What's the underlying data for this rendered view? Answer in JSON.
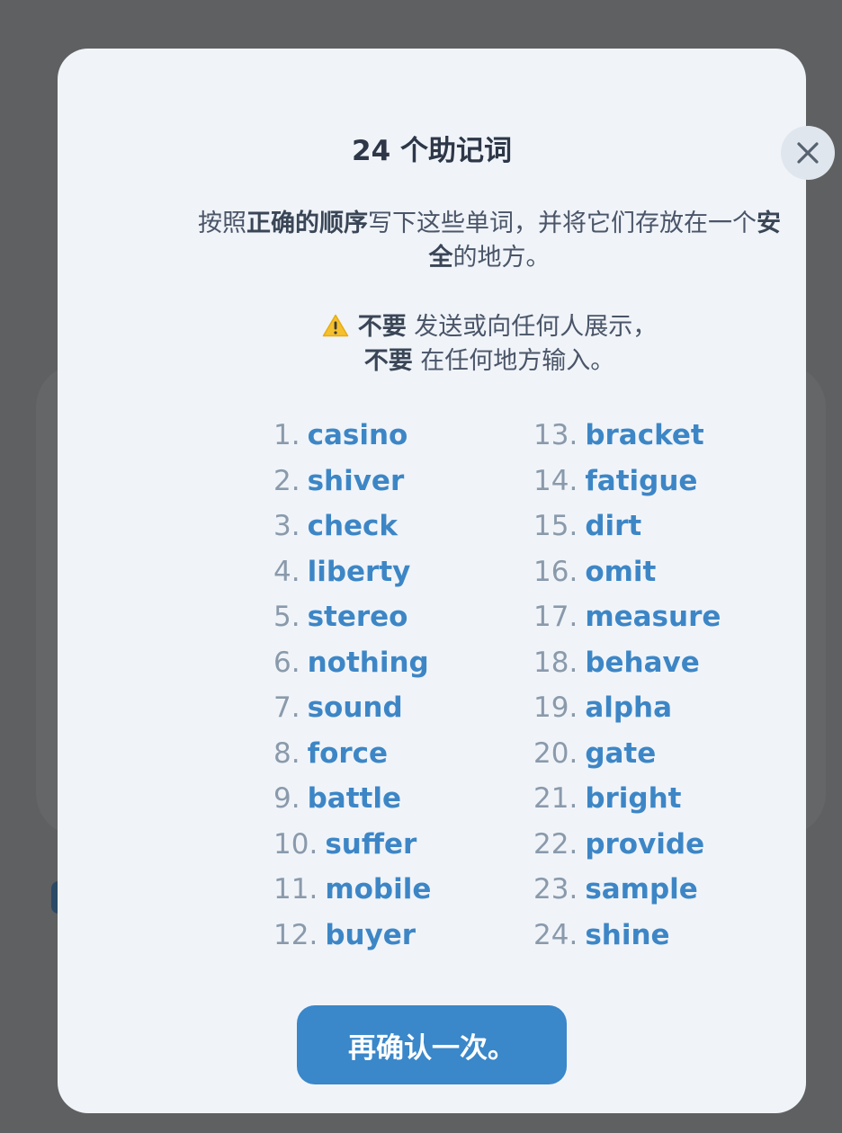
{
  "modal": {
    "title": "24 个助记词",
    "close_icon": "close-icon",
    "description": {
      "p1": "按照",
      "b1": "正确的顺序",
      "p2": "写下这些单词，并将它们存放在一个",
      "b2": "安全",
      "p3": "的地方。"
    },
    "warning": {
      "icon": "warning-icon",
      "bold1": "不要",
      "text1": " 发送或向任何人展示，",
      "bold2": "不要",
      "text2": " 在任何地方输入。"
    },
    "words": [
      {
        "n": "1.",
        "w": "casino"
      },
      {
        "n": "2.",
        "w": "shiver"
      },
      {
        "n": "3.",
        "w": "check"
      },
      {
        "n": "4.",
        "w": "liberty"
      },
      {
        "n": "5.",
        "w": "stereo"
      },
      {
        "n": "6.",
        "w": "nothing"
      },
      {
        "n": "7.",
        "w": "sound"
      },
      {
        "n": "8.",
        "w": "force"
      },
      {
        "n": "9.",
        "w": "battle"
      },
      {
        "n": "10.",
        "w": "suffer"
      },
      {
        "n": "11.",
        "w": "mobile"
      },
      {
        "n": "12.",
        "w": "buyer"
      },
      {
        "n": "13.",
        "w": "bracket"
      },
      {
        "n": "14.",
        "w": "fatigue"
      },
      {
        "n": "15.",
        "w": "dirt"
      },
      {
        "n": "16.",
        "w": "omit"
      },
      {
        "n": "17.",
        "w": "measure"
      },
      {
        "n": "18.",
        "w": "behave"
      },
      {
        "n": "19.",
        "w": "alpha"
      },
      {
        "n": "20.",
        "w": "gate"
      },
      {
        "n": "21.",
        "w": "bright"
      },
      {
        "n": "22.",
        "w": "provide"
      },
      {
        "n": "23.",
        "w": "sample"
      },
      {
        "n": "24.",
        "w": "shine"
      }
    ],
    "confirm_label": "再确认一次。"
  },
  "colors": {
    "overlay": "#5f6061",
    "modal_bg": "#f0f4f9",
    "accent": "#3a87c9",
    "word": "#3d86c6",
    "number": "#8a9aab",
    "warning": "#f5c02e"
  }
}
